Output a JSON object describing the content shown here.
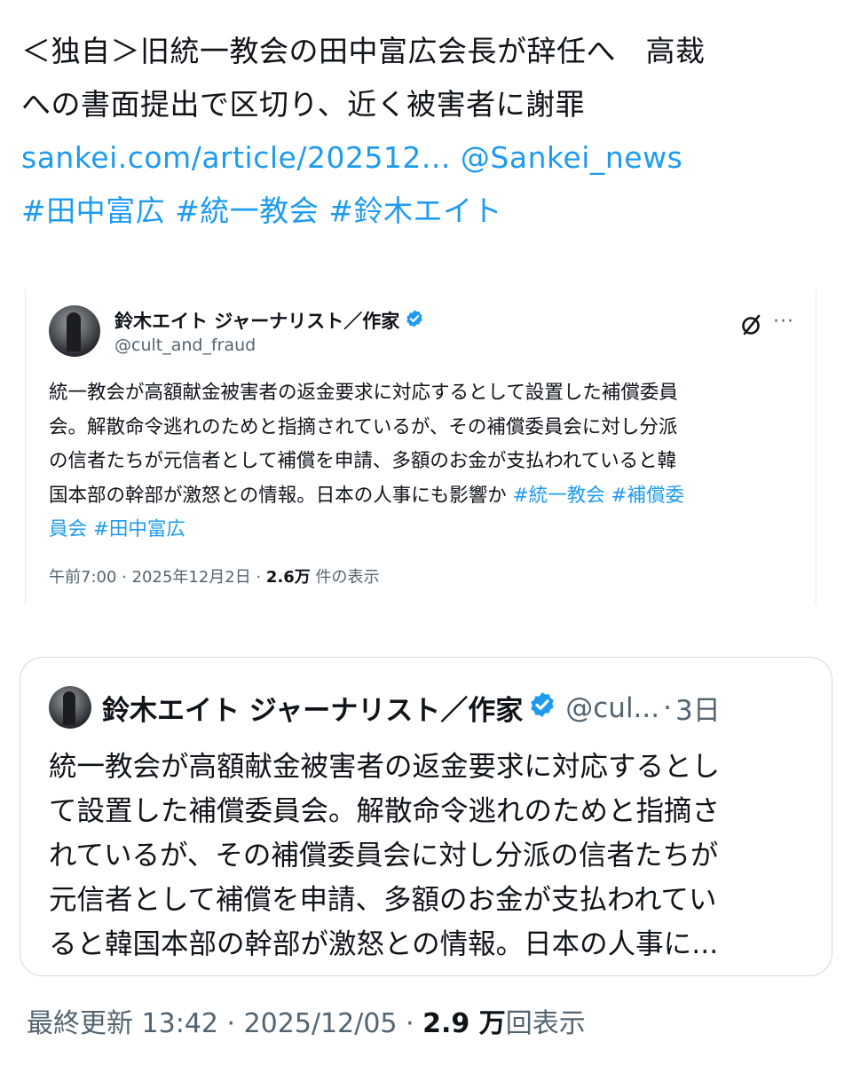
{
  "tweet": {
    "text_line1": "＜独自＞旧統一教会の田中富広会長が辞任へ　高裁",
    "text_line2": "への書面提出で区切り、近く被害者に謝罪",
    "link": "sankei.com/article/202512...",
    "mention": "@Sankei_news",
    "hashtags": [
      "#田中富広",
      "#統一教会",
      "#鈴木エイト"
    ]
  },
  "embedded_post": {
    "author_name": "鈴木エイト ジャーナリスト／作家",
    "handle": "@cult_and_fraud",
    "lines": [
      "統一教会が高額献金被害者の返金要求に対応するとして設置した補償委員",
      "会。解散命令逃れのためと指摘されているが、その補償委員会に対し分派",
      "の信者たちが元信者として補償を申請、多額のお金が支払われていると韓",
      "国本部の幹部が激怒との情報。日本の人事にも影響か "
    ],
    "hashtag_a": "#統一教会",
    "hashtag_b": "#補償委",
    "hashtag_b_cont": "員会",
    "hashtag_c": "#田中富広",
    "timestamp": "午前7:00 · 2025年12月2日 · ",
    "views": "2.6万",
    "views_suffix": " 件の表示",
    "more": "···"
  },
  "quote": {
    "author_name": "鈴木エイト ジャーナリスト／作家",
    "handle": "@cul...",
    "separator": "·",
    "time": "3日",
    "lines": [
      "統一教会が高額献金被害者の返金要求に対応するとし",
      "て設置した補償委員会。解散命令逃れのためと指摘さ",
      "れているが、その補償委員会に対し分派の信者たちが",
      "元信者として補償を申請、多額のお金が支払われてい",
      "ると韓国本部の幹部が激怒との情報。日本の人事に..."
    ]
  },
  "footer": {
    "updated": "最終更新 13:42 · 2025/12/05 · ",
    "views": "2.9 万",
    "views_suffix": "回表示"
  },
  "colors": {
    "link": "#1d9bf0",
    "secondary_text": "#536471",
    "verified": "#1d9bf0"
  }
}
